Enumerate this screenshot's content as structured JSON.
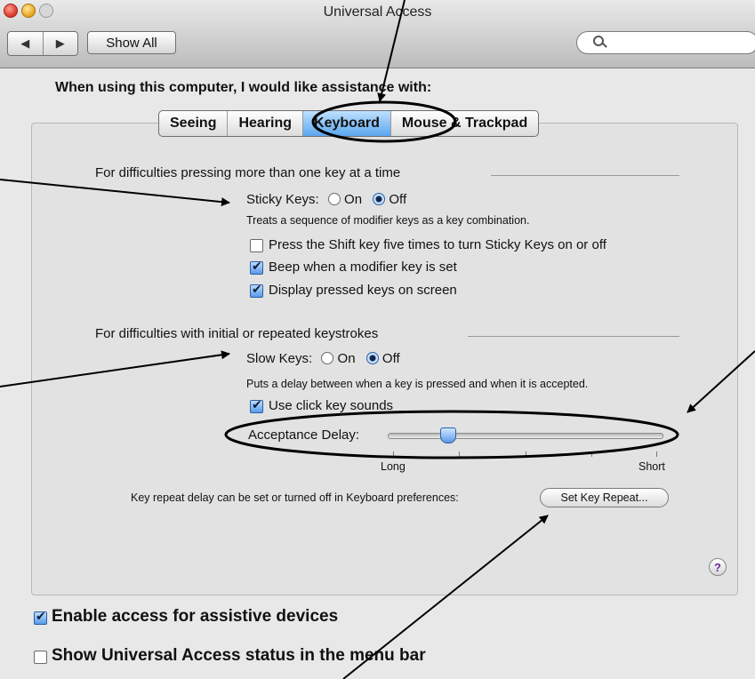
{
  "window": {
    "title": "Universal Access",
    "show_all_label": "Show All",
    "back_icon": "◀",
    "forward_icon": "▶",
    "search_placeholder": ""
  },
  "heading": "When using this computer, I would like assistance with:",
  "tabs": [
    {
      "label": "Seeing",
      "active": false
    },
    {
      "label": "Hearing",
      "active": false
    },
    {
      "label": "Keyboard",
      "active": true
    },
    {
      "label": "Mouse & Trackpad",
      "active": false
    }
  ],
  "sticky": {
    "group_label": "For difficulties pressing more than one key at a time",
    "label": "Sticky Keys:",
    "on_label": "On",
    "off_label": "Off",
    "selected": "Off",
    "description": "Treats a sequence of modifier keys as a key combination.",
    "options": [
      {
        "label": "Press the Shift key five times to turn Sticky Keys on or off",
        "checked": false
      },
      {
        "label": "Beep when a modifier key is set",
        "checked": true
      },
      {
        "label": "Display pressed keys on screen",
        "checked": true
      }
    ]
  },
  "slow": {
    "group_label": "For difficulties with initial or repeated keystrokes",
    "label": "Slow Keys:",
    "on_label": "On",
    "off_label": "Off",
    "selected": "Off",
    "description": "Puts a delay between when a key is pressed and when it is accepted.",
    "click_sounds_label": "Use click key sounds",
    "click_sounds_checked": true,
    "delay_label": "Acceptance Delay:",
    "delay_value": 0.2,
    "long_label": "Long",
    "short_label": "Short"
  },
  "key_repeat": {
    "note": "Key repeat delay can be set or turned off in Keyboard preferences:",
    "button_label": "Set Key Repeat..."
  },
  "help_label": "?",
  "footer": {
    "assistive_label": "Enable access for assistive devices",
    "assistive_checked": true,
    "status_label": "Show Universal Access status in the menu bar",
    "status_checked": false
  }
}
